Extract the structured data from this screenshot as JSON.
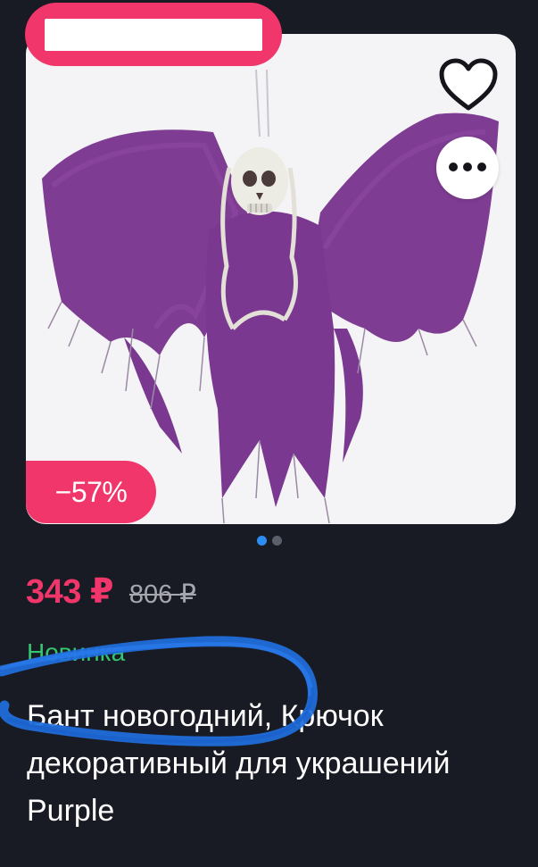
{
  "promo_badge": {
    "text": ""
  },
  "icons": {
    "favorite": "heart-outline-icon",
    "more": "more-dots-icon"
  },
  "discount_badge": "−57%",
  "carousel": {
    "total": 2,
    "active_index": 0
  },
  "price": {
    "current": "343 ₽",
    "old": "806 ₽"
  },
  "label_new": "Новинка",
  "product_title": "Бант новогодний, Крючок декоративный для украшений Purple",
  "colors": {
    "accent_pink": "#f0366a",
    "background": "#191b24",
    "new_green": "#35c66f",
    "dot_active": "#2c8df2",
    "annotation_blue": "#1f6fe0"
  }
}
